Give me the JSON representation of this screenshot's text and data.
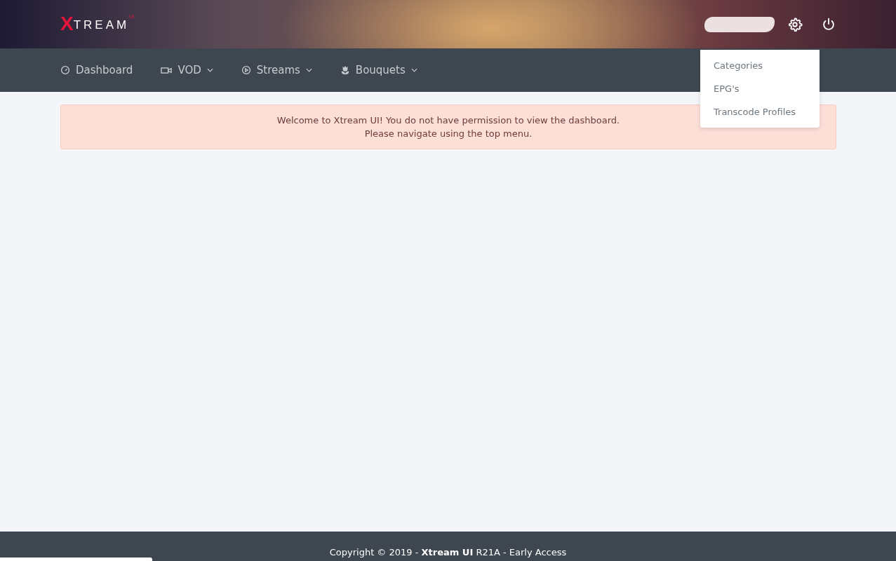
{
  "logo": {
    "mark": "X",
    "text": "TREAM",
    "sup": "UI"
  },
  "nav": [
    {
      "label": "Dashboard",
      "kind": "gauge",
      "dropdown": false
    },
    {
      "label": "VOD",
      "kind": "camera",
      "dropdown": true
    },
    {
      "label": "Streams",
      "kind": "play",
      "dropdown": true
    },
    {
      "label": "Bouquets",
      "kind": "flower",
      "dropdown": true
    }
  ],
  "settings_menu": {
    "expanded": true,
    "items": [
      "Categories",
      "EPG's",
      "Transcode Profiles"
    ]
  },
  "alert": {
    "lines": [
      "Welcome to Xtream UI! You do not have permission to view the dashboard.",
      "Please navigate using the top menu."
    ]
  },
  "footer": {
    "text": "Copyright © 2019 - **Xtream UI** R21A - Early Access"
  }
}
